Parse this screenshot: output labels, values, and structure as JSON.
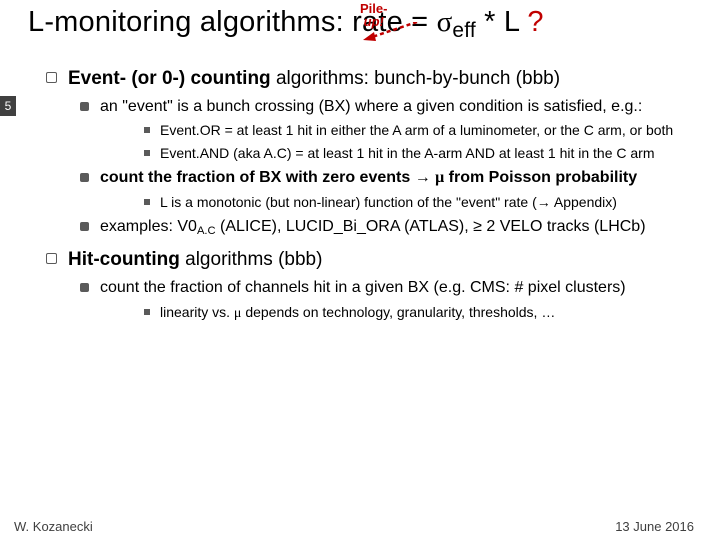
{
  "slide_number": "5",
  "pileup": {
    "line1": "Pile-",
    "line2": "up!"
  },
  "title": {
    "t1": "L-monitoring algorithms: rate = ",
    "sigma": "σ",
    "sub": "eff",
    "t2": " * L ",
    "qmark": "?"
  },
  "b1": {
    "lead": "Event- (or 0-) counting ",
    "rest": "algorithms: bunch-by-bunch (bbb)",
    "s1": "an \"event\" is a bunch crossing (BX) where a given condition is satisfied, e.g.:",
    "s1a": "Event.OR = at least 1 hit in either the A arm of a luminometer, or the C arm, or both",
    "s1b": "Event.AND (aka A.C) = at least 1 hit in the A-arm AND at least 1 hit in the C arm",
    "s2_a": "count the fraction of BX with zero events ",
    "s2_b": " ",
    "s2_mu": "μ",
    "s2_c": " from Poisson probability",
    "s2a_a": "L is a monotonic (but non-linear) function of the \"event\" rate (",
    "s2a_b": " Appendix)",
    "s3_a": "examples: V0",
    "s3_sub": "A.C",
    "s3_b": " (ALICE), LUCID_Bi_ORA (ATLAS), ≥ 2 VELO tracks (LHCb)"
  },
  "b2": {
    "lead": "Hit-counting ",
    "rest": "algorithms (bbb)",
    "s1": "count the fraction of channels hit in a given BX (e.g. CMS: # pixel clusters)",
    "s1a_a": "linearity vs. ",
    "s1a_mu": "μ",
    "s1a_b": " depends on technology, granularity, thresholds, …"
  },
  "footer": {
    "left": "W. Kozanecki",
    "right": "13 June 2016"
  }
}
